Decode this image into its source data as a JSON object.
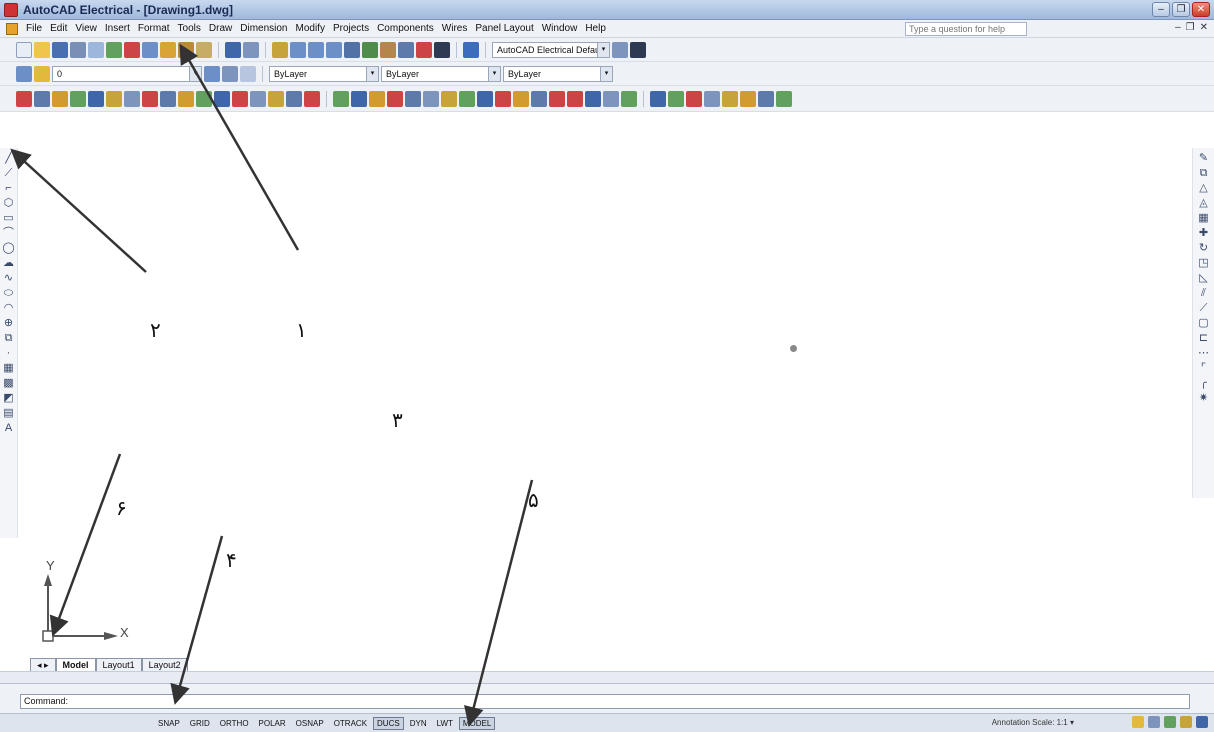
{
  "window": {
    "title": "AutoCAD Electrical - [Drawing1.dwg]",
    "minimize_glyph": "–",
    "restore_glyph": "❐",
    "close_glyph": "✕"
  },
  "menu": {
    "items": [
      "File",
      "Edit",
      "View",
      "Insert",
      "Format",
      "Tools",
      "Draw",
      "Dimension",
      "Modify",
      "Projects",
      "Components",
      "Wires",
      "Panel Layout",
      "Window",
      "Help"
    ],
    "search_placeholder": "Type a question for help",
    "mdi_minimize": "–",
    "mdi_restore": "❐",
    "mdi_close": "✕"
  },
  "toolbars": {
    "workspace": "AutoCAD Electrical Default",
    "layer": "0",
    "color": "ByLayer",
    "linetype": "ByLayer",
    "lineweight": "ByLayer",
    "dropdown_glyph": "▾"
  },
  "annotations": {
    "label_1": "۱",
    "label_2": "۲",
    "label_3": "۳",
    "label_4": "۴",
    "label_5": "۵",
    "label_6": "۶"
  },
  "ucs": {
    "x_label": "X",
    "y_label": "Y"
  },
  "layout_tabs": {
    "items": [
      "Model",
      "Layout1",
      "Layout2"
    ],
    "active": "Model"
  },
  "command": {
    "prompt": "Command:"
  },
  "statusbar": {
    "coords": "",
    "toggles": [
      "SNAP",
      "GRID",
      "ORTHO",
      "POLAR",
      "OSNAP",
      "OTRACK",
      "DUCS",
      "DYN",
      "LWT",
      "MODEL"
    ],
    "active_toggles": [
      "DUCS",
      "MODEL"
    ],
    "annotation_scale": "Annotation Scale: 1:1 ▾"
  },
  "colors": {
    "titlebar": "#9fb8dc",
    "menubar": "#eef1f6",
    "canvas": "#ffffff",
    "arrow": "#333333"
  },
  "icons": {
    "left_toolbar": [
      "line-icon",
      "construction-line-icon",
      "polyline-icon",
      "polygon-icon",
      "rectangle-icon",
      "arc-icon",
      "circle-icon",
      "revision-cloud-icon",
      "spline-icon",
      "ellipse-icon",
      "ellipse-arc-icon",
      "insert-block-icon",
      "make-block-icon",
      "point-icon",
      "hatch-icon",
      "gradient-icon",
      "region-icon",
      "table-icon",
      "multiline-text-icon"
    ],
    "right_toolbar": [
      "erase-icon",
      "copy-icon",
      "mirror-icon",
      "offset-icon",
      "array-icon",
      "move-icon",
      "rotate-icon",
      "scale-icon",
      "stretch-icon",
      "trim-icon",
      "extend-icon",
      "break-at-point-icon",
      "break-icon",
      "join-icon",
      "chamfer-icon",
      "fillet-icon",
      "explode-icon"
    ]
  }
}
